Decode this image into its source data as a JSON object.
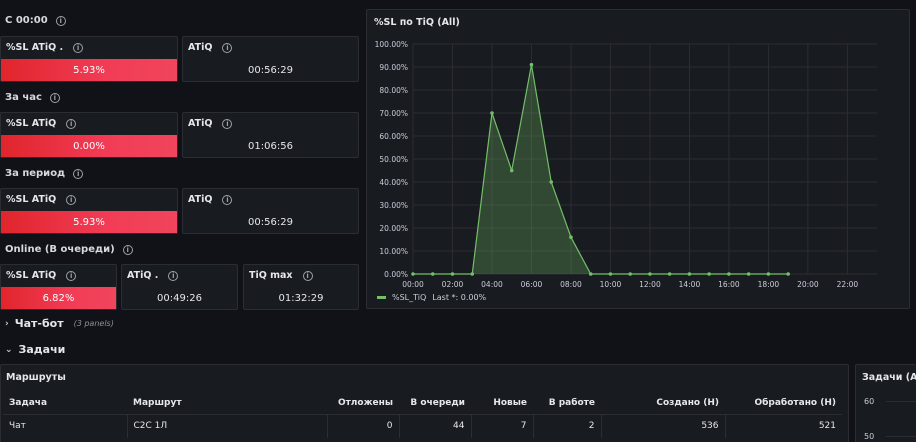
{
  "sections": {
    "since_midnight": "С 00:00",
    "per_hour": "За час",
    "per_period": "За период",
    "online": "Online (В очереди)"
  },
  "stats": {
    "r1": {
      "sl_title": "%SL ATiQ .",
      "sl_value": "5.93%",
      "atiq_title": "ATiQ",
      "atiq_value": "00:56:29"
    },
    "r2": {
      "sl_title": "%SL ATiQ",
      "sl_value": "0.00%",
      "atiq_title": "ATiQ",
      "atiq_value": "01:06:56"
    },
    "r3": {
      "sl_title": "%SL ATiQ",
      "sl_value": "5.93%",
      "atiq_title": "ATiQ",
      "atiq_value": "00:56:29"
    },
    "r4": {
      "sl_title": "%SL ATiQ",
      "sl_value": "6.82%",
      "atiq_title": "ATiQ .",
      "atiq_value": "00:49:26",
      "tiq_title": "TiQ max",
      "tiq_value": "01:32:29"
    }
  },
  "chart_panel": {
    "title": "%SL по TiQ (All)",
    "legend_name": "%SL_TiQ",
    "legend_last": "Last *: 0.00%"
  },
  "chart_data": {
    "type": "area",
    "y_ticks": [
      "100.00%",
      "90.00%",
      "80.00%",
      "70.00%",
      "60.00%",
      "50.00%",
      "40.00%",
      "30.00%",
      "20.00%",
      "10.00%",
      "0.00%"
    ],
    "x_ticks": [
      "00:00",
      "02:00",
      "04:00",
      "06:00",
      "08:00",
      "10:00",
      "12:00",
      "14:00",
      "16:00",
      "18:00",
      "20:00",
      "22:00"
    ],
    "ylim": [
      0,
      100
    ],
    "xlim": [
      0,
      23.5
    ],
    "x": [
      0,
      1,
      2,
      3,
      4,
      5,
      6,
      7,
      8,
      9,
      10,
      11,
      12,
      13,
      14,
      15,
      16,
      17,
      18,
      19
    ],
    "series": [
      {
        "name": "%SL_TiQ",
        "color": "#73bf69",
        "values": [
          0,
          0,
          0,
          0,
          70,
          45,
          91,
          40,
          16,
          0,
          0,
          0,
          0,
          0,
          0,
          0,
          0,
          0,
          0,
          0
        ]
      }
    ]
  },
  "rows": {
    "chat_bot": {
      "label": "Чат-бот",
      "count": "(3 panels)"
    },
    "tasks": {
      "label": "Задачи"
    }
  },
  "routes_panel": {
    "title": "Маршруты",
    "headers": [
      "Задача",
      "Маршрут",
      "Отложены",
      "В очереди",
      "Новые",
      "В работе",
      "Создано (Н)",
      "Обработано (Н)"
    ],
    "rows": [
      [
        "Чат",
        "C2C 1Л",
        "0",
        "44",
        "7",
        "2",
        "536",
        "521"
      ]
    ]
  },
  "tasks_panel": {
    "title": "Задачи (All)",
    "y_ticks": [
      "60",
      "50"
    ]
  },
  "colors": {
    "accent_red": "#f23c56",
    "series_green": "#73bf69",
    "bg": "#111217",
    "panel": "#181b1f"
  }
}
